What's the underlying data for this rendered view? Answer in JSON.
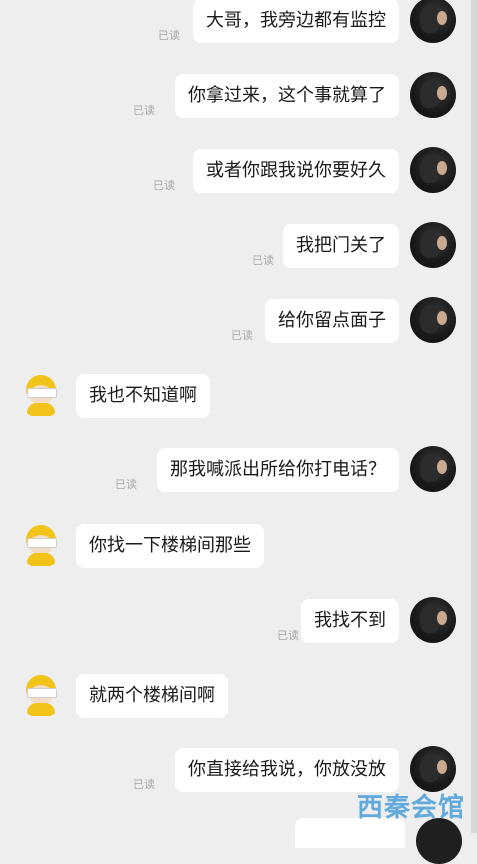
{
  "read_receipt": "已读",
  "watermark": "西秦会馆",
  "messages": [
    {
      "side": "sent",
      "text": "大哥，我旁边都有监控"
    },
    {
      "side": "sent",
      "text": "你拿过来，这个事就算了"
    },
    {
      "side": "sent",
      "text": "或者你跟我说你要好久"
    },
    {
      "side": "sent",
      "text": "我把门关了"
    },
    {
      "side": "sent",
      "text": "给你留点面子"
    },
    {
      "side": "received",
      "text": "我也不知道啊"
    },
    {
      "side": "sent",
      "text": "那我喊派出所给你打电话？"
    },
    {
      "side": "received",
      "text": "你找一下楼梯间那些"
    },
    {
      "side": "sent",
      "text": "我找不到"
    },
    {
      "side": "received",
      "text": "就两个楼梯间啊"
    },
    {
      "side": "sent",
      "text": "你直接给我说，你放没放"
    }
  ]
}
